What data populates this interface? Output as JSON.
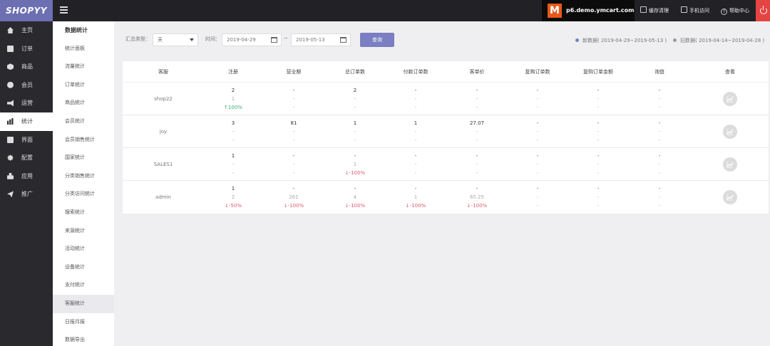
{
  "topbar": {
    "logo": "SHOPYY",
    "site_badge": "M",
    "site_name": "p6.demo.ymcart.com",
    "links": [
      "缓存清理",
      "手机访问",
      "帮助中心"
    ]
  },
  "sidebar_primary": {
    "items": [
      {
        "label": "主页",
        "icon": "home-icon"
      },
      {
        "label": "订单",
        "icon": "order-icon"
      },
      {
        "label": "商品",
        "icon": "product-icon"
      },
      {
        "label": "会员",
        "icon": "member-icon"
      },
      {
        "label": "运营",
        "icon": "megaphone-icon"
      },
      {
        "label": "统计",
        "icon": "bar-chart-icon"
      },
      {
        "label": "界面",
        "icon": "window-icon"
      },
      {
        "label": "配置",
        "icon": "gear-icon"
      },
      {
        "label": "应用",
        "icon": "apps-icon"
      },
      {
        "label": "推广",
        "icon": "send-icon"
      }
    ],
    "active_index": 5
  },
  "sidebar_secondary": {
    "title": "数据统计",
    "items": [
      "统计面板",
      "流量统计",
      "订单统计",
      "商品统计",
      "会员统计",
      "会员销售统计",
      "国家统计",
      "分类销售统计",
      "分类访问统计",
      "搜索统计",
      "来源统计",
      "活动统计",
      "设备统计",
      "支付统计",
      "客服统计",
      "日报月报",
      "数据导出"
    ],
    "active_index": 14
  },
  "filter": {
    "type_label": "汇总类型：",
    "type_value": "天",
    "time_label": "时间：",
    "start_date": "2019-04-29",
    "separator": "~",
    "end_date": "2019-05-13",
    "query_button": "查询",
    "legend_new": "新数据( 2019-04-29~2019-05-13 )",
    "legend_old": "旧数据( 2019-04-14~2019-04-28 )",
    "legend_new_color": "#7b7ec1",
    "legend_old_color": "#9a9a9a"
  },
  "table": {
    "columns": [
      "客服",
      "注册",
      "营业额",
      "总订单数",
      "付款订单数",
      "客单价",
      "复购订单数",
      "复购订单金额",
      "询盘",
      "查看"
    ],
    "rows": [
      {
        "name": "shop22",
        "cells": [
          [
            "2",
            "1",
            "↑100%"
          ],
          [
            "-",
            "-",
            "-"
          ],
          [
            "2",
            "-",
            "-"
          ],
          [
            "-",
            "-",
            "-"
          ],
          [
            "-",
            "-",
            "-"
          ],
          [
            "-",
            "-",
            "-"
          ],
          [
            "-",
            "-",
            "-"
          ],
          [
            "-",
            "-",
            "-"
          ]
        ],
        "trend": [
          "",
          "",
          "up",
          "",
          "",
          "",
          "",
          "",
          ""
        ]
      },
      {
        "name": "joy",
        "cells": [
          [
            "3",
            "-",
            "-"
          ],
          [
            "81",
            "-",
            "-"
          ],
          [
            "1",
            "-",
            "-"
          ],
          [
            "1",
            "-",
            "-"
          ],
          [
            "27.07",
            "-",
            "-"
          ],
          [
            "-",
            "-",
            "-"
          ],
          [
            "-",
            "-",
            "-"
          ],
          [
            "-",
            "-",
            "-"
          ]
        ]
      },
      {
        "name": "SALES1",
        "cells": [
          [
            "1",
            "-",
            "-"
          ],
          [
            "-",
            "-",
            "-"
          ],
          [
            "-",
            "1",
            "↓-100%"
          ],
          [
            "-",
            "-",
            "-"
          ],
          [
            "-",
            "-",
            "-"
          ],
          [
            "-",
            "-",
            "-"
          ],
          [
            "-",
            "-",
            "-"
          ],
          [
            "-",
            "-",
            "-"
          ]
        ]
      },
      {
        "name": "admin",
        "cells": [
          [
            "1",
            "2",
            "↓-50%"
          ],
          [
            "-",
            "261",
            "↓-100%"
          ],
          [
            "-",
            "4",
            "↓-100%"
          ],
          [
            "-",
            "1",
            "↓-100%"
          ],
          [
            "-",
            "65.25",
            "↓-100%"
          ],
          [
            "-",
            "-",
            "-"
          ],
          [
            "-",
            "-",
            "-"
          ],
          [
            "-",
            "-",
            "-"
          ]
        ]
      }
    ],
    "view_icon": "trend-chart-icon"
  }
}
